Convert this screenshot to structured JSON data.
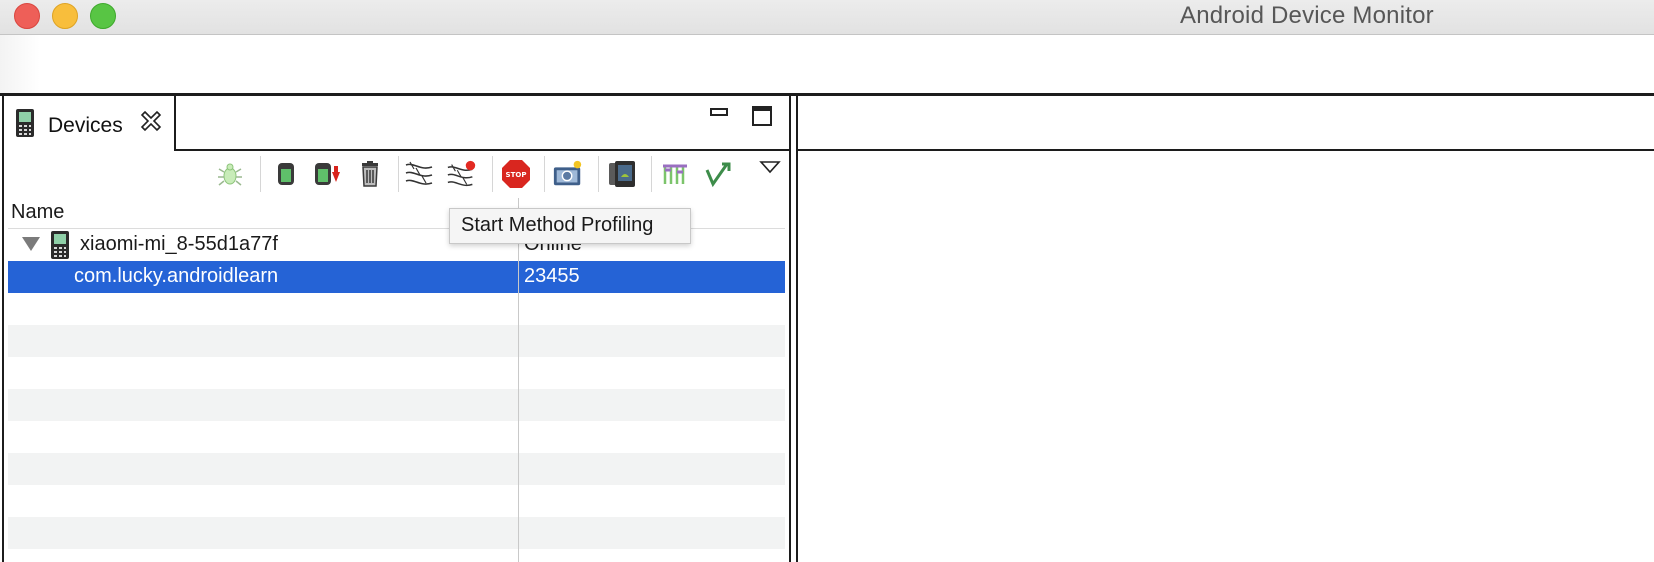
{
  "window": {
    "title": "Android Device Monitor"
  },
  "devices_view": {
    "tab_label": "Devices",
    "toolbar": [
      {
        "name": "debug-process-icon"
      },
      {
        "name": "update-heap-icon"
      },
      {
        "name": "dump-hprof-icon"
      },
      {
        "name": "cause-gc-icon"
      },
      {
        "name": "update-threads-icon"
      },
      {
        "name": "start-method-profiling-icon"
      },
      {
        "name": "stop-process-icon"
      },
      {
        "name": "screen-capture-icon"
      },
      {
        "name": "dump-view-hierarchy-icon"
      },
      {
        "name": "systrace-icon"
      },
      {
        "name": "start-opengl-trace-icon"
      },
      {
        "name": "view-menu-icon"
      }
    ],
    "table": {
      "columns": [
        "Name",
        ""
      ],
      "rows": [
        {
          "name": "xiaomi-mi_8-55d1a77f",
          "value": "Online",
          "type": "device"
        },
        {
          "name": "com.lucky.androidlearn",
          "value": "23455",
          "type": "process",
          "selected": true
        }
      ]
    },
    "tooltip": "Start Method Profiling"
  },
  "colors": {
    "selection": "#2563d6",
    "close": "#ee5f58",
    "minimize": "#f8be3c",
    "maximize": "#58c544"
  }
}
